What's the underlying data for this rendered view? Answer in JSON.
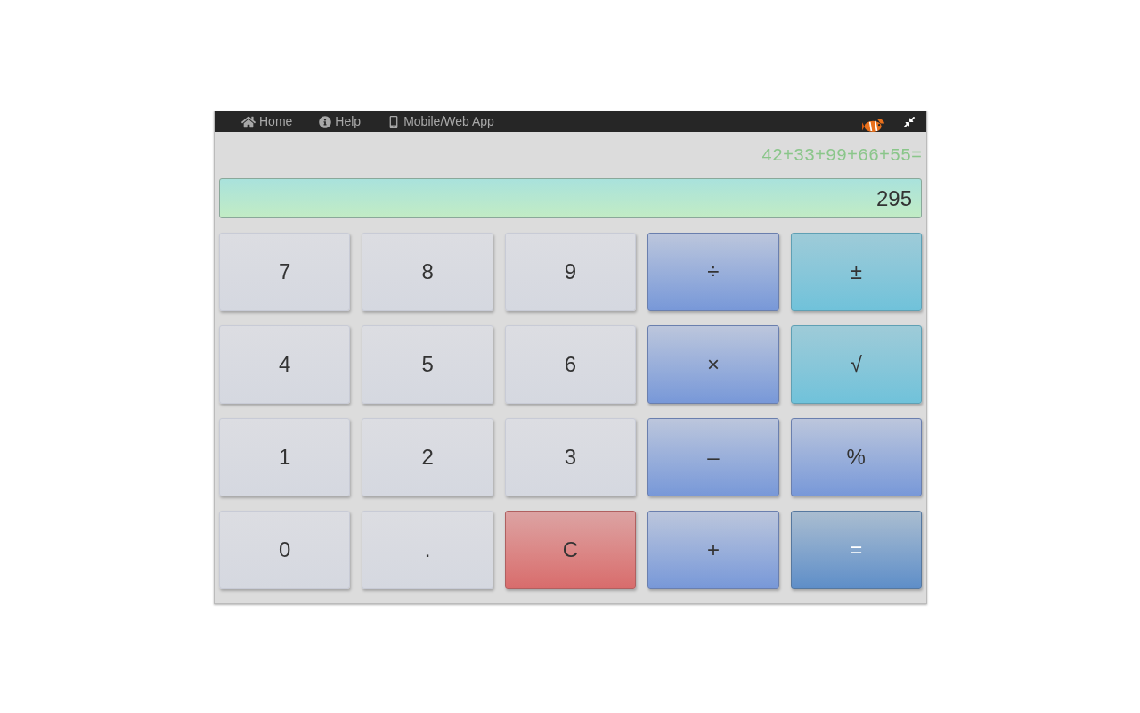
{
  "nav": [
    {
      "label": "Home"
    },
    {
      "label": "Help"
    },
    {
      "label": "Mobile/Web App"
    }
  ],
  "expression": "42+33+99+66+55=",
  "display": "295",
  "keys": [
    {
      "label": "7",
      "kind": "digit"
    },
    {
      "label": "8",
      "kind": "digit"
    },
    {
      "label": "9",
      "kind": "digit"
    },
    {
      "label": "÷",
      "kind": "op"
    },
    {
      "label": "±",
      "kind": "func"
    },
    {
      "label": "4",
      "kind": "digit"
    },
    {
      "label": "5",
      "kind": "digit"
    },
    {
      "label": "6",
      "kind": "digit"
    },
    {
      "label": "×",
      "kind": "op"
    },
    {
      "label": "√",
      "kind": "func"
    },
    {
      "label": "1",
      "kind": "digit"
    },
    {
      "label": "2",
      "kind": "digit"
    },
    {
      "label": "3",
      "kind": "digit"
    },
    {
      "label": "–",
      "kind": "op"
    },
    {
      "label": "%",
      "kind": "op"
    },
    {
      "label": "0",
      "kind": "digit"
    },
    {
      "label": ".",
      "kind": "digit"
    },
    {
      "label": "C",
      "kind": "clear"
    },
    {
      "label": "+",
      "kind": "op"
    },
    {
      "label": "=",
      "kind": "equals"
    }
  ]
}
